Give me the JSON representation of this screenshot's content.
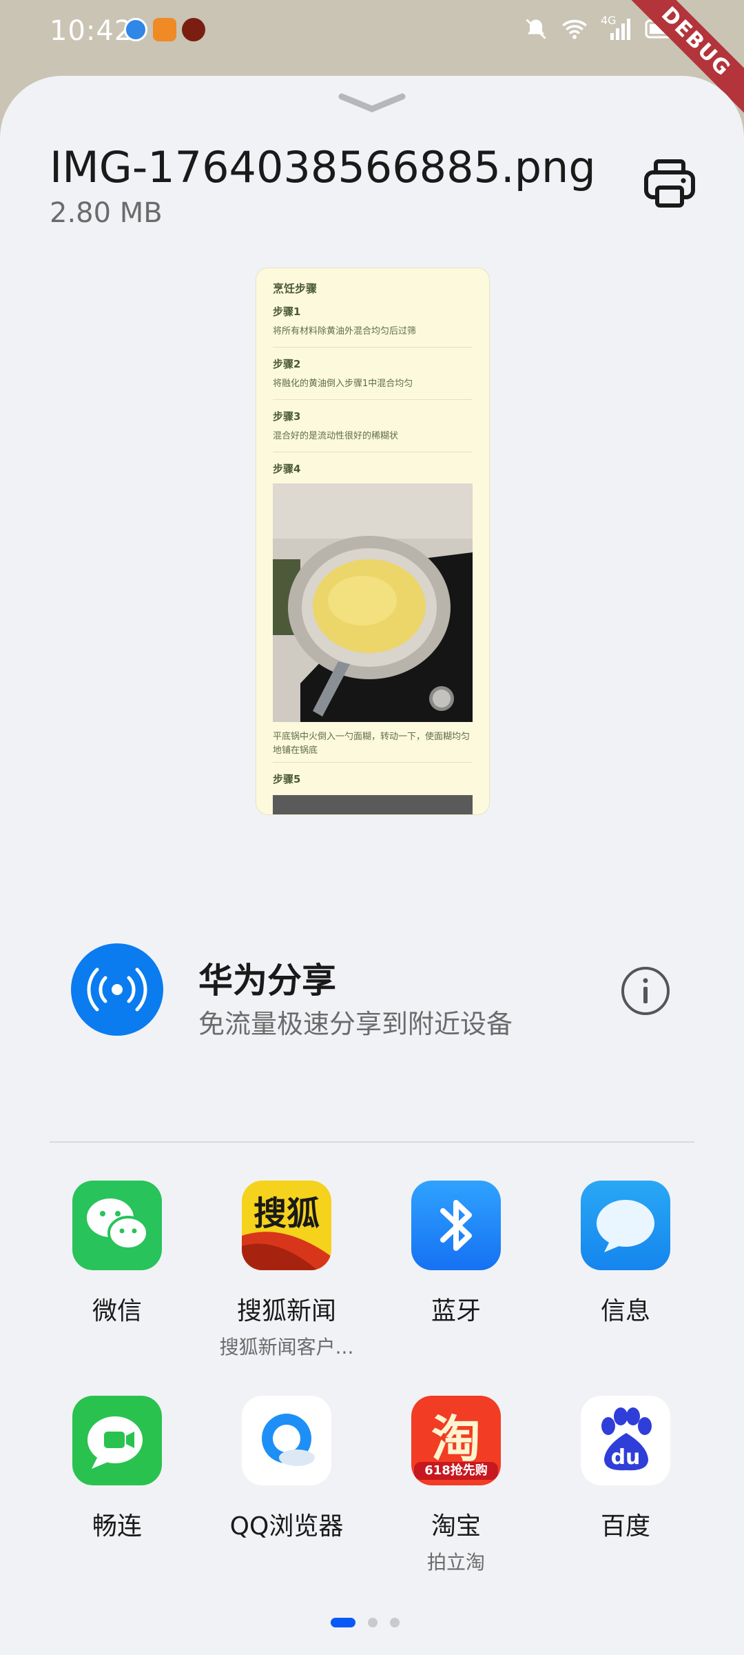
{
  "status_bar": {
    "time": "10:42",
    "signal_label": "4G",
    "debug_badge": "DEBUG"
  },
  "file": {
    "name": "IMG-1764038566885.png",
    "size": "2.80 MB"
  },
  "preview": {
    "title": "烹饪步骤",
    "steps": [
      {
        "label": "步骤1",
        "desc": "将所有材料除黄油外混合均匀后过筛"
      },
      {
        "label": "步骤2",
        "desc": "将融化的黄油倒入步骤1中混合均匀"
      },
      {
        "label": "步骤3",
        "desc": "混合好的是流动性很好的稀糊状"
      },
      {
        "label": "步骤4",
        "desc": "平底锅中火倒入一勺面糊，转动一下，使面糊均匀地铺在锅底"
      },
      {
        "label": "步骤5",
        "desc": ""
      }
    ]
  },
  "huawei_share": {
    "title": "华为分享",
    "subtitle": "免流量极速分享到附近设备"
  },
  "apps": [
    {
      "label": "微信",
      "sub": "",
      "icon": "wechat-icon"
    },
    {
      "label": "搜狐新闻",
      "sub": "搜狐新闻客户...",
      "icon": "sohu-news-icon",
      "icon_text": "搜狐"
    },
    {
      "label": "蓝牙",
      "sub": "",
      "icon": "bluetooth-icon"
    },
    {
      "label": "信息",
      "sub": "",
      "icon": "messages-icon"
    },
    {
      "label": "畅连",
      "sub": "",
      "icon": "meetime-icon"
    },
    {
      "label": "QQ浏览器",
      "sub": "",
      "icon": "qq-browser-icon"
    },
    {
      "label": "淘宝",
      "sub": "拍立淘",
      "icon": "taobao-icon",
      "icon_text": "淘",
      "icon_banner": "618抢先购"
    },
    {
      "label": "百度",
      "sub": "",
      "icon": "baidu-icon",
      "icon_text": "du"
    }
  ],
  "pagination": {
    "current": 1,
    "total": 3
  },
  "colors": {
    "accent": "#0a59f7",
    "share_blue": "#0a7cf0",
    "sheet_bg": "#f1f2f5"
  }
}
